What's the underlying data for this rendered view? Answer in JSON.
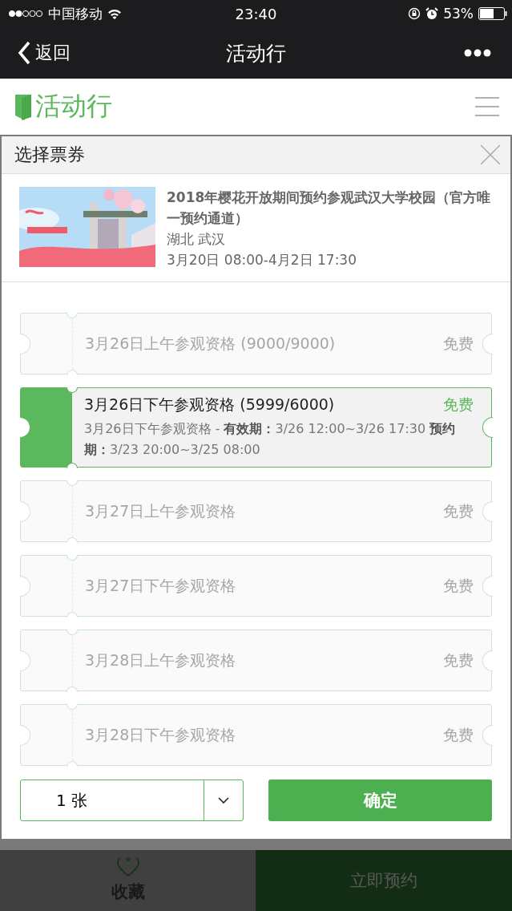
{
  "status_bar": {
    "carrier": "中国移动",
    "time": "23:40",
    "battery": "53%"
  },
  "nav": {
    "back": "返回",
    "title": "活动行"
  },
  "site_header": {
    "logo": "活动行"
  },
  "bottom_bar": {
    "favorite": "收藏",
    "book": "立即预约"
  },
  "dialog": {
    "title": "选择票券",
    "event": {
      "kind": "picture",
      "title": "2018年樱花开放期间预约参观武汉大学校园（官方唯一预约通道）",
      "location": "湖北 武汉",
      "time": "3月20日 08:00-4月2日 17:30"
    },
    "tickets": [
      {
        "name": "3月26日上午参观资格 (9000/9000)",
        "price": "免费",
        "selected": false
      },
      {
        "name": "3月26日下午参观资格 (5999/6000)",
        "price": "免费",
        "selected": true,
        "detail": "3月26日下午参观资格 - **有效期：**3/26 12:00~3/26 17:30 **预约期：**3/23 20:00~3/25 08:00"
      },
      {
        "name": "3月27日上午参观资格",
        "price": "免费",
        "selected": false
      },
      {
        "name": "3月27日下午参观资格",
        "price": "免费",
        "selected": false
      },
      {
        "name": "3月28日上午参观资格",
        "price": "免费",
        "selected": false
      },
      {
        "name": "3月28日下午参观资格",
        "price": "免费",
        "selected": false
      }
    ],
    "quantity": "1 张",
    "confirm": "确定"
  }
}
